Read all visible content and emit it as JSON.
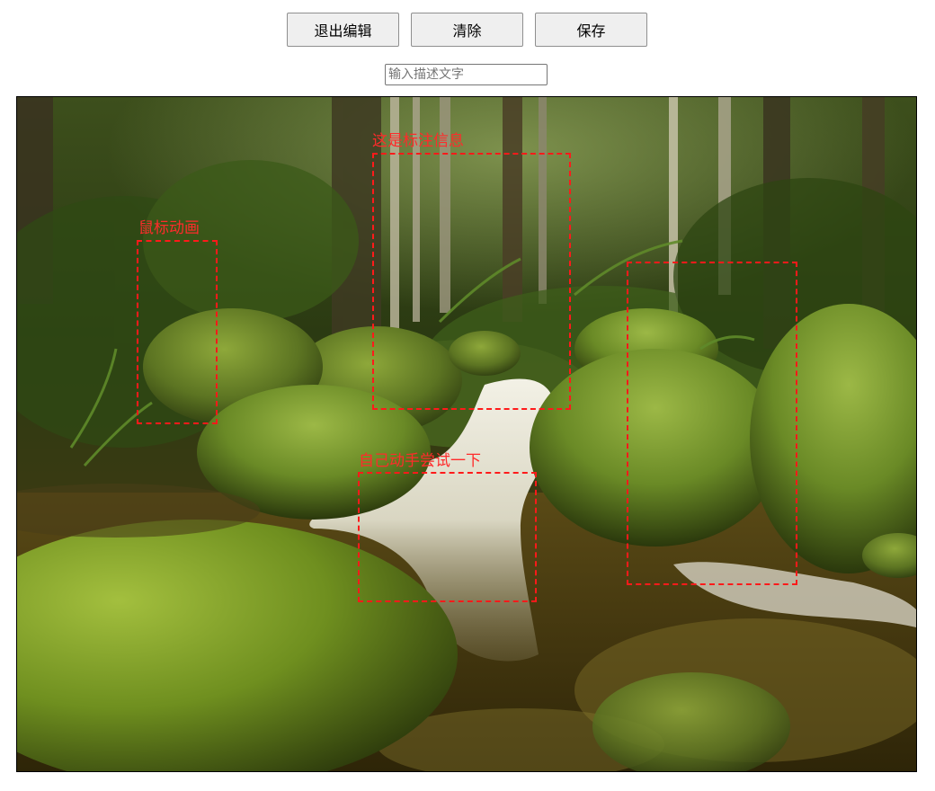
{
  "toolbar": {
    "exit_label": "退出编辑",
    "clear_label": "清除",
    "save_label": "保存"
  },
  "description_input": {
    "placeholder": "输入描述文字",
    "value": ""
  },
  "annotations": [
    {
      "label": "这是标注信息"
    },
    {
      "label": "鼠标动画"
    },
    {
      "label": "自己动手尝试一下"
    },
    {
      "label": ""
    }
  ],
  "colors": {
    "annotation": "#ff1a1a",
    "button_bg": "#efefef",
    "button_border": "#8f8f8f"
  },
  "image": {
    "subject_icon": "forest-stream-photo"
  }
}
